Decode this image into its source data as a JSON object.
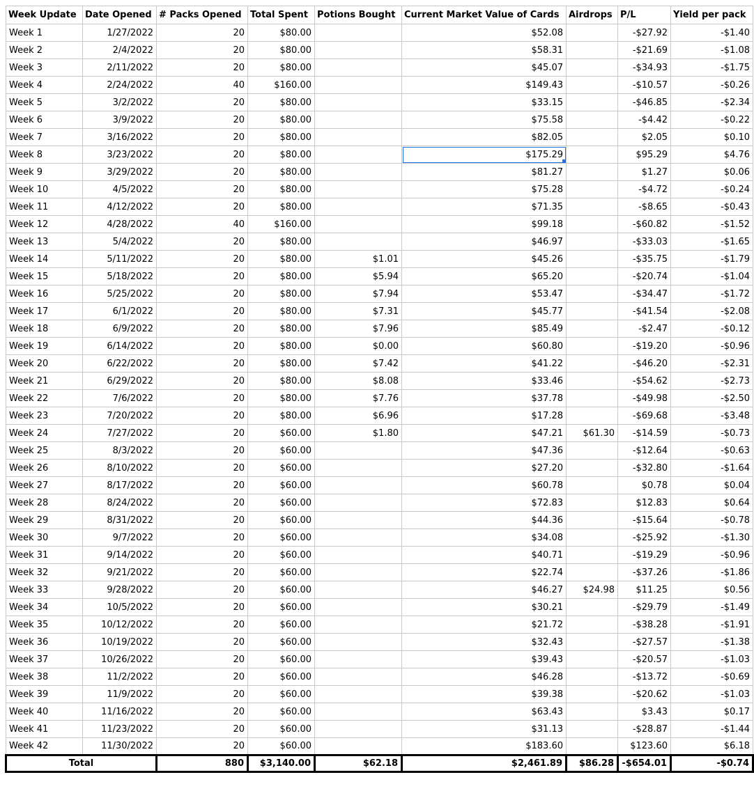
{
  "headers": [
    "Week Update",
    "Date Opened",
    "# Packs Opened",
    "Total Spent",
    "Potions Bought",
    "Current Market Value of Cards",
    "Airdrops",
    "P/L",
    "Yield per pack"
  ],
  "rows": [
    [
      "Week 1",
      "1/27/2022",
      "20",
      "$80.00",
      "",
      "$52.08",
      "",
      "-$27.92",
      "-$1.40"
    ],
    [
      "Week 2",
      "2/4/2022",
      "20",
      "$80.00",
      "",
      "$58.31",
      "",
      "-$21.69",
      "-$1.08"
    ],
    [
      "Week 3",
      "2/11/2022",
      "20",
      "$80.00",
      "",
      "$45.07",
      "",
      "-$34.93",
      "-$1.75"
    ],
    [
      "Week 4",
      "2/24/2022",
      "40",
      "$160.00",
      "",
      "$149.43",
      "",
      "-$10.57",
      "-$0.26"
    ],
    [
      "Week 5",
      "3/2/2022",
      "20",
      "$80.00",
      "",
      "$33.15",
      "",
      "-$46.85",
      "-$2.34"
    ],
    [
      "Week 6",
      "3/9/2022",
      "20",
      "$80.00",
      "",
      "$75.58",
      "",
      "-$4.42",
      "-$0.22"
    ],
    [
      "Week 7",
      "3/16/2022",
      "20",
      "$80.00",
      "",
      "$82.05",
      "",
      "$2.05",
      "$0.10"
    ],
    [
      "Week 8",
      "3/23/2022",
      "20",
      "$80.00",
      "",
      "$175.29",
      "",
      "$95.29",
      "$4.76"
    ],
    [
      "Week 9",
      "3/29/2022",
      "20",
      "$80.00",
      "",
      "$81.27",
      "",
      "$1.27",
      "$0.06"
    ],
    [
      "Week 10",
      "4/5/2022",
      "20",
      "$80.00",
      "",
      "$75.28",
      "",
      "-$4.72",
      "-$0.24"
    ],
    [
      "Week 11",
      "4/12/2022",
      "20",
      "$80.00",
      "",
      "$71.35",
      "",
      "-$8.65",
      "-$0.43"
    ],
    [
      "Week 12",
      "4/28/2022",
      "40",
      "$160.00",
      "",
      "$99.18",
      "",
      "-$60.82",
      "-$1.52"
    ],
    [
      "Week 13",
      "5/4/2022",
      "20",
      "$80.00",
      "",
      "$46.97",
      "",
      "-$33.03",
      "-$1.65"
    ],
    [
      "Week 14",
      "5/11/2022",
      "20",
      "$80.00",
      "$1.01",
      "$45.26",
      "",
      "-$35.75",
      "-$1.79"
    ],
    [
      "Week 15",
      "5/18/2022",
      "20",
      "$80.00",
      "$5.94",
      "$65.20",
      "",
      "-$20.74",
      "-$1.04"
    ],
    [
      "Week 16",
      "5/25/2022",
      "20",
      "$80.00",
      "$7.94",
      "$53.47",
      "",
      "-$34.47",
      "-$1.72"
    ],
    [
      "Week 17",
      "6/1/2022",
      "20",
      "$80.00",
      "$7.31",
      "$45.77",
      "",
      "-$41.54",
      "-$2.08"
    ],
    [
      "Week 18",
      "6/9/2022",
      "20",
      "$80.00",
      "$7.96",
      "$85.49",
      "",
      "-$2.47",
      "-$0.12"
    ],
    [
      "Week 19",
      "6/14/2022",
      "20",
      "$80.00",
      "$0.00",
      "$60.80",
      "",
      "-$19.20",
      "-$0.96"
    ],
    [
      "Week 20",
      "6/22/2022",
      "20",
      "$80.00",
      "$7.42",
      "$41.22",
      "",
      "-$46.20",
      "-$2.31"
    ],
    [
      "Week 21",
      "6/29/2022",
      "20",
      "$80.00",
      "$8.08",
      "$33.46",
      "",
      "-$54.62",
      "-$2.73"
    ],
    [
      "Week 22",
      "7/6/2022",
      "20",
      "$80.00",
      "$7.76",
      "$37.78",
      "",
      "-$49.98",
      "-$2.50"
    ],
    [
      "Week 23",
      "7/20/2022",
      "20",
      "$80.00",
      "$6.96",
      "$17.28",
      "",
      "-$69.68",
      "-$3.48"
    ],
    [
      "Week 24",
      "7/27/2022",
      "20",
      "$60.00",
      "$1.80",
      "$47.21",
      "$61.30",
      "-$14.59",
      "-$0.73"
    ],
    [
      "Week 25",
      "8/3/2022",
      "20",
      "$60.00",
      "",
      "$47.36",
      "",
      "-$12.64",
      "-$0.63"
    ],
    [
      "Week 26",
      "8/10/2022",
      "20",
      "$60.00",
      "",
      "$27.20",
      "",
      "-$32.80",
      "-$1.64"
    ],
    [
      "Week 27",
      "8/17/2022",
      "20",
      "$60.00",
      "",
      "$60.78",
      "",
      "$0.78",
      "$0.04"
    ],
    [
      "Week 28",
      "8/24/2022",
      "20",
      "$60.00",
      "",
      "$72.83",
      "",
      "$12.83",
      "$0.64"
    ],
    [
      "Week 29",
      "8/31/2022",
      "20",
      "$60.00",
      "",
      "$44.36",
      "",
      "-$15.64",
      "-$0.78"
    ],
    [
      "Week 30",
      "9/7/2022",
      "20",
      "$60.00",
      "",
      "$34.08",
      "",
      "-$25.92",
      "-$1.30"
    ],
    [
      "Week 31",
      "9/14/2022",
      "20",
      "$60.00",
      "",
      "$40.71",
      "",
      "-$19.29",
      "-$0.96"
    ],
    [
      "Week 32",
      "9/21/2022",
      "20",
      "$60.00",
      "",
      "$22.74",
      "",
      "-$37.26",
      "-$1.86"
    ],
    [
      "Week 33",
      "9/28/2022",
      "20",
      "$60.00",
      "",
      "$46.27",
      "$24.98",
      "$11.25",
      "$0.56"
    ],
    [
      "Week 34",
      "10/5/2022",
      "20",
      "$60.00",
      "",
      "$30.21",
      "",
      "-$29.79",
      "-$1.49"
    ],
    [
      "Week 35",
      "10/12/2022",
      "20",
      "$60.00",
      "",
      "$21.72",
      "",
      "-$38.28",
      "-$1.91"
    ],
    [
      "Week 36",
      "10/19/2022",
      "20",
      "$60.00",
      "",
      "$32.43",
      "",
      "-$27.57",
      "-$1.38"
    ],
    [
      "Week 37",
      "10/26/2022",
      "20",
      "$60.00",
      "",
      "$39.43",
      "",
      "-$20.57",
      "-$1.03"
    ],
    [
      "Week 38",
      "11/2/2022",
      "20",
      "$60.00",
      "",
      "$46.28",
      "",
      "-$13.72",
      "-$0.69"
    ],
    [
      "Week 39",
      "11/9/2022",
      "20",
      "$60.00",
      "",
      "$39.38",
      "",
      "-$20.62",
      "-$1.03"
    ],
    [
      "Week 40",
      "11/16/2022",
      "20",
      "$60.00",
      "",
      "$63.43",
      "",
      "$3.43",
      "$0.17"
    ],
    [
      "Week 41",
      "11/23/2022",
      "20",
      "$60.00",
      "",
      "$31.13",
      "",
      "-$28.87",
      "-$1.44"
    ],
    [
      "Week 42",
      "11/30/2022",
      "20",
      "$60.00",
      "",
      "$183.60",
      "",
      "$123.60",
      "$6.18"
    ]
  ],
  "total": [
    "Total",
    "",
    "880",
    "$3,140.00",
    "$62.18",
    "$2,461.89",
    "$86.28",
    "-$654.01",
    "-$0.74"
  ],
  "selected_cell": {
    "row": 8,
    "column": "Current Market Value of Cards"
  },
  "colors": {
    "selection": "#1a73e8",
    "gridline": "#c8c8c8",
    "total_border": "#000000"
  }
}
